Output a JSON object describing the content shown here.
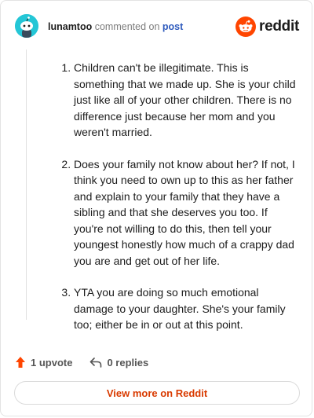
{
  "header": {
    "username": "lunamtoo",
    "commented_on": "commented on",
    "post_link": "post",
    "brand": "reddit"
  },
  "comment": {
    "items": [
      "Children can't be illegitimate. This is something that we made up. She is your child just like all of your other children. There is no difference just because her mom and you weren't married.",
      "Does your family not know about her? If not, I think you need to own up to this as her father and explain to your family that they have a sibling and that she deserves you too. If you're not willing to do this, then tell your youngest honestly how much of a crappy dad you are and get out of her life.",
      "YTA you are doing so much emotional damage to your daughter. She's your family too; either be in or out at this point."
    ]
  },
  "actions": {
    "upvote_label": "1 upvote",
    "replies_label": "0 replies"
  },
  "footer": {
    "view_more_label": "View more on Reddit"
  },
  "colors": {
    "accent": "#d93a00",
    "upvote": "#ff4500",
    "link": "#2f5bbd",
    "avatar_bg": "#24c6d6"
  },
  "icons": {
    "avatar": "snoo-avatar-icon",
    "logo": "reddit-logo-icon",
    "upvote": "upvote-arrow-icon",
    "reply": "reply-arrow-icon"
  }
}
